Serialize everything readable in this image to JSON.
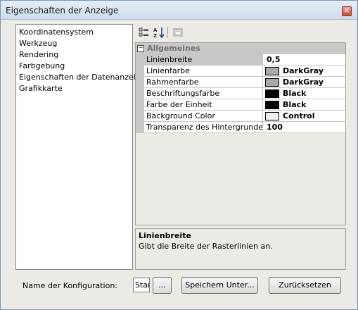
{
  "window": {
    "title": "Eigenschaften der Anzeige",
    "close_glyph": "✕"
  },
  "categories": [
    "Koordinatensystem",
    "Werkzeug",
    "Rendering",
    "Farbgebung",
    "Eigenschaften der Datenanzeige",
    "Grafikkarte"
  ],
  "property_grid": {
    "toolbar_icons": [
      "categorized-icon",
      "alphabetical-sort-icon",
      "property-pages-icon"
    ],
    "category": {
      "label": "Allgemeines",
      "toggle": "−"
    },
    "rows": [
      {
        "name": "Linienbreite",
        "value": "0,5",
        "swatch": null,
        "selected": true
      },
      {
        "name": "Linienfarbe",
        "value": "DarkGray",
        "swatch": "#a9a9a9",
        "selected": false
      },
      {
        "name": "Rahmenfarbe",
        "value": "DarkGray",
        "swatch": "#a9a9a9",
        "selected": false
      },
      {
        "name": "Beschriftungsfarbe",
        "value": "Black",
        "swatch": "#000000",
        "selected": false
      },
      {
        "name": "Farbe der Einheit",
        "value": "Black",
        "swatch": "#000000",
        "selected": false
      },
      {
        "name": "Background Color",
        "value": "Control",
        "swatch": "#f0f0f0",
        "selected": false
      },
      {
        "name": "Transparenz des Hintergrundes",
        "value": "100",
        "swatch": null,
        "selected": false
      }
    ],
    "help": {
      "title": "Linienbreite",
      "description": "Gibt die Breite der Rasterlinien an."
    }
  },
  "footer": {
    "config_label": "Name der Konfiguration:",
    "config_value": "Standard",
    "browse_label": "...",
    "save_as_label": "Speichern Unter...",
    "reset_label": "Zurücksetzen"
  }
}
